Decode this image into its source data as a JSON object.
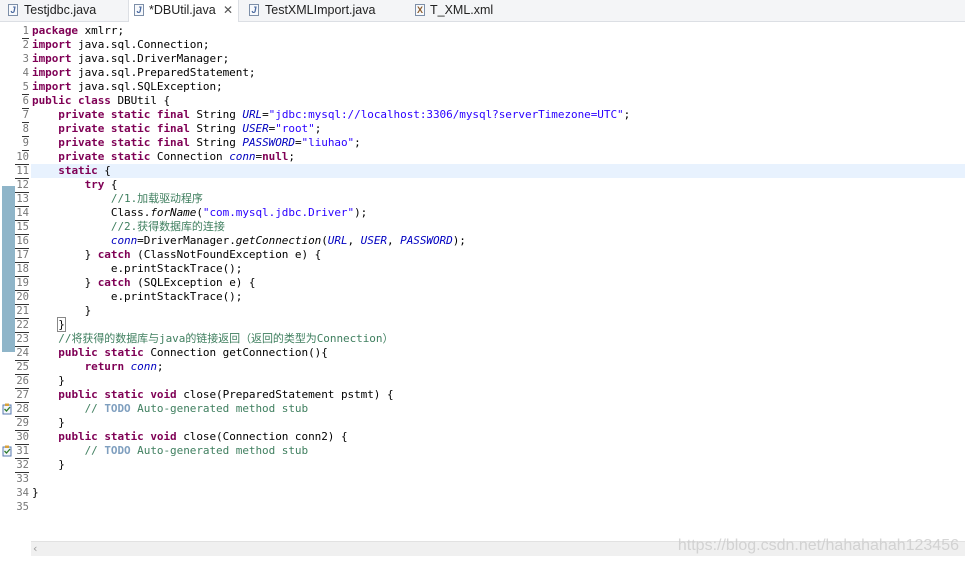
{
  "tabs": [
    {
      "label": "Testjdbc.java",
      "icon": "J",
      "active": false,
      "dirty": false
    },
    {
      "label": "*DBUtil.java",
      "icon": "J",
      "active": true,
      "close": "✕"
    },
    {
      "label": "TestXMLImport.java",
      "icon": "J",
      "active": false
    },
    {
      "label": "T_XML.xml",
      "icon": "X",
      "active": false
    }
  ],
  "editor": {
    "line_numbers": [
      "1",
      "2",
      "3",
      "4",
      "5",
      "6",
      "7",
      "8",
      "9",
      "10",
      "11",
      "12",
      "13",
      "14",
      "15",
      "16",
      "17",
      "18",
      "19",
      "20",
      "21",
      "22",
      "23",
      "24",
      "25",
      "26",
      "27",
      "28",
      "29",
      "30",
      "31",
      "32",
      "33",
      "34",
      "35"
    ],
    "lines": [
      [
        [
          "kw",
          "package"
        ],
        [
          "t",
          " xmlrr;"
        ]
      ],
      [
        [
          "kw",
          "import"
        ],
        [
          "t",
          " java.sql.Connection;"
        ]
      ],
      [
        [
          "kw",
          "import"
        ],
        [
          "t",
          " java.sql.DriverManager;"
        ]
      ],
      [
        [
          "kw",
          "import"
        ],
        [
          "t",
          " java.sql.PreparedStatement;"
        ]
      ],
      [
        [
          "kw",
          "import"
        ],
        [
          "t",
          " java.sql.SQLException;"
        ]
      ],
      [
        [
          "kw",
          "public"
        ],
        [
          "t",
          " "
        ],
        [
          "kw",
          "class"
        ],
        [
          "t",
          " DBUtil {"
        ]
      ],
      [
        [
          "t",
          "    "
        ],
        [
          "kw",
          "private"
        ],
        [
          "t",
          " "
        ],
        [
          "kw",
          "static"
        ],
        [
          "t",
          " "
        ],
        [
          "kw",
          "final"
        ],
        [
          "t",
          " String "
        ],
        [
          "fld",
          "URL"
        ],
        [
          "t",
          "="
        ],
        [
          "str",
          "\"jdbc:mysql://localhost:3306/mysql?serverTimezone=UTC\""
        ],
        [
          "t",
          ";"
        ]
      ],
      [
        [
          "t",
          "    "
        ],
        [
          "kw",
          "private"
        ],
        [
          "t",
          " "
        ],
        [
          "kw",
          "static"
        ],
        [
          "t",
          " "
        ],
        [
          "kw",
          "final"
        ],
        [
          "t",
          " String "
        ],
        [
          "fld",
          "USER"
        ],
        [
          "t",
          "="
        ],
        [
          "str",
          "\"root\""
        ],
        [
          "t",
          ";"
        ]
      ],
      [
        [
          "t",
          "    "
        ],
        [
          "kw",
          "private"
        ],
        [
          "t",
          " "
        ],
        [
          "kw",
          "static"
        ],
        [
          "t",
          " "
        ],
        [
          "kw",
          "final"
        ],
        [
          "t",
          " String "
        ],
        [
          "fld",
          "PASSWORD"
        ],
        [
          "t",
          "="
        ],
        [
          "str",
          "\"liuhao\""
        ],
        [
          "t",
          ";"
        ]
      ],
      [
        [
          "t",
          "    "
        ],
        [
          "kw",
          "private"
        ],
        [
          "t",
          " "
        ],
        [
          "kw",
          "static"
        ],
        [
          "t",
          " Connection "
        ],
        [
          "fld",
          "conn"
        ],
        [
          "t",
          "="
        ],
        [
          "kw",
          "null"
        ],
        [
          "t",
          ";"
        ]
      ],
      [
        [
          "t",
          "    "
        ],
        [
          "kw",
          "static"
        ],
        [
          "t",
          " {"
        ]
      ],
      [
        [
          "t",
          "        "
        ],
        [
          "kw",
          "try"
        ],
        [
          "t",
          " {"
        ]
      ],
      [
        [
          "t",
          "            "
        ],
        [
          "cm",
          "//1.加载驱动程序"
        ]
      ],
      [
        [
          "t",
          "            Class."
        ],
        [
          "it",
          "forName"
        ],
        [
          "t",
          "("
        ],
        [
          "str",
          "\"com.mysql.jdbc.Driver\""
        ],
        [
          "t",
          ");"
        ]
      ],
      [
        [
          "t",
          "            "
        ],
        [
          "cm",
          "//2.获得数据库的连接"
        ]
      ],
      [
        [
          "t",
          "            "
        ],
        [
          "fld",
          "conn"
        ],
        [
          "t",
          "=DriverManager."
        ],
        [
          "it",
          "getConnection"
        ],
        [
          "t",
          "("
        ],
        [
          "fld",
          "URL"
        ],
        [
          "t",
          ", "
        ],
        [
          "fld",
          "USER"
        ],
        [
          "t",
          ", "
        ],
        [
          "fld",
          "PASSWORD"
        ],
        [
          "t",
          ");"
        ]
      ],
      [
        [
          "t",
          "        } "
        ],
        [
          "kw",
          "catch"
        ],
        [
          "t",
          " (ClassNotFoundException e) {"
        ]
      ],
      [
        [
          "t",
          "            e.printStackTrace();"
        ]
      ],
      [
        [
          "t",
          "        } "
        ],
        [
          "kw",
          "catch"
        ],
        [
          "t",
          " (SQLException e) {"
        ]
      ],
      [
        [
          "t",
          "            e.printStackTrace();"
        ]
      ],
      [
        [
          "t",
          "        }"
        ]
      ],
      [
        [
          "t",
          "    "
        ],
        [
          "br",
          "}"
        ]
      ],
      [
        [
          "t",
          "    "
        ],
        [
          "cm",
          "//将获得的数据库与java的链接返回（返回的类型为Connection）"
        ]
      ],
      [
        [
          "t",
          "    "
        ],
        [
          "kw",
          "public"
        ],
        [
          "t",
          " "
        ],
        [
          "kw",
          "static"
        ],
        [
          "t",
          " Connection getConnection(){"
        ]
      ],
      [
        [
          "t",
          "        "
        ],
        [
          "kw",
          "return"
        ],
        [
          "t",
          " "
        ],
        [
          "fld",
          "conn"
        ],
        [
          "t",
          ";"
        ]
      ],
      [
        [
          "t",
          "    }"
        ]
      ],
      [
        [
          "t",
          "    "
        ],
        [
          "kw",
          "public"
        ],
        [
          "t",
          " "
        ],
        [
          "kw",
          "static"
        ],
        [
          "t",
          " "
        ],
        [
          "kw",
          "void"
        ],
        [
          "t",
          " close(PreparedStatement pstmt) {"
        ]
      ],
      [
        [
          "t",
          "        "
        ],
        [
          "cm",
          "// "
        ],
        [
          "todo",
          "TODO"
        ],
        [
          "cm",
          " Auto-generated method stub"
        ]
      ],
      [
        [
          "t",
          "    }"
        ]
      ],
      [
        [
          "t",
          "    "
        ],
        [
          "kw",
          "public"
        ],
        [
          "t",
          " "
        ],
        [
          "kw",
          "static"
        ],
        [
          "t",
          " "
        ],
        [
          "kw",
          "void"
        ],
        [
          "t",
          " close(Connection conn2) {"
        ]
      ],
      [
        [
          "t",
          "        "
        ],
        [
          "cm",
          "// "
        ],
        [
          "todo",
          "TODO"
        ],
        [
          "cm",
          " Auto-generated method stub"
        ]
      ],
      [
        [
          "t",
          "    }"
        ]
      ],
      [
        [
          "t",
          ""
        ]
      ],
      [
        [
          "t",
          "}"
        ]
      ],
      [
        [
          "t",
          ""
        ]
      ]
    ],
    "underlined_numbers": [
      1,
      5,
      6,
      7,
      8,
      9,
      10,
      11,
      12,
      13,
      14,
      15,
      16,
      17,
      18,
      19,
      20,
      21,
      22,
      23,
      24,
      25,
      26,
      27,
      28,
      29,
      30,
      31,
      32
    ],
    "todo_marker_lines": [
      28,
      31
    ]
  },
  "watermark": "https://blog.csdn.net/hahahahah123456",
  "colors": {
    "keyword": "#7f0055",
    "field": "#0000c0",
    "string": "#2a00ff",
    "comment": "#3f7f5f",
    "todo": "#7f9fbf",
    "current_line": "#e8f2fe",
    "collapse_bar": "#8fb5c9"
  }
}
